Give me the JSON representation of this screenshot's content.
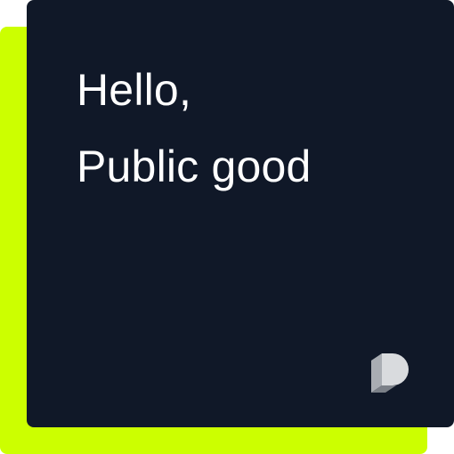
{
  "card": {
    "headline_line1": "Hello,",
    "headline_line2": "Public good"
  },
  "logo": {
    "icon": "public-good-p-logo-icon"
  },
  "colors": {
    "card_background": "#101828",
    "accent": "#CCFF00",
    "headline_text": "#FFFFFF",
    "logo_light": "#D9DBDE",
    "logo_mid": "#A9ADB3",
    "logo_dark": "#7B8088"
  }
}
